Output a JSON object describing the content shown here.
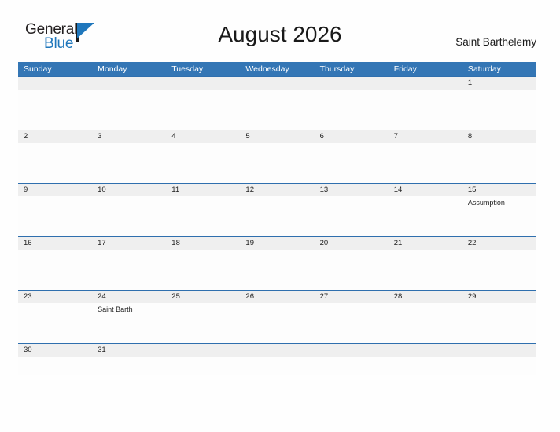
{
  "brand": {
    "name_part1": "General",
    "name_part2": "Blue",
    "flag_icon": "flag-icon",
    "accent_color": "#1f77bc"
  },
  "header": {
    "title": "August 2026",
    "region": "Saint Barthelemy"
  },
  "colors": {
    "weekday_header_bg": "#3476b5",
    "weekday_header_text": "#ffffff",
    "daynum_band_bg": "#efefef",
    "row_divider": "#2f6fae",
    "page_bg": "#fefefe",
    "text": "#222222"
  },
  "calendar": {
    "weekdays": [
      "Sunday",
      "Monday",
      "Tuesday",
      "Wednesday",
      "Thursday",
      "Friday",
      "Saturday"
    ],
    "weeks": [
      {
        "days": [
          {
            "number": "",
            "event": ""
          },
          {
            "number": "",
            "event": ""
          },
          {
            "number": "",
            "event": ""
          },
          {
            "number": "",
            "event": ""
          },
          {
            "number": "",
            "event": ""
          },
          {
            "number": "",
            "event": ""
          },
          {
            "number": "1",
            "event": ""
          }
        ]
      },
      {
        "days": [
          {
            "number": "2",
            "event": ""
          },
          {
            "number": "3",
            "event": ""
          },
          {
            "number": "4",
            "event": ""
          },
          {
            "number": "5",
            "event": ""
          },
          {
            "number": "6",
            "event": ""
          },
          {
            "number": "7",
            "event": ""
          },
          {
            "number": "8",
            "event": ""
          }
        ]
      },
      {
        "days": [
          {
            "number": "9",
            "event": ""
          },
          {
            "number": "10",
            "event": ""
          },
          {
            "number": "11",
            "event": ""
          },
          {
            "number": "12",
            "event": ""
          },
          {
            "number": "13",
            "event": ""
          },
          {
            "number": "14",
            "event": ""
          },
          {
            "number": "15",
            "event": "Assumption"
          }
        ]
      },
      {
        "days": [
          {
            "number": "16",
            "event": ""
          },
          {
            "number": "17",
            "event": ""
          },
          {
            "number": "18",
            "event": ""
          },
          {
            "number": "19",
            "event": ""
          },
          {
            "number": "20",
            "event": ""
          },
          {
            "number": "21",
            "event": ""
          },
          {
            "number": "22",
            "event": ""
          }
        ]
      },
      {
        "days": [
          {
            "number": "23",
            "event": ""
          },
          {
            "number": "24",
            "event": "Saint Barth"
          },
          {
            "number": "25",
            "event": ""
          },
          {
            "number": "26",
            "event": ""
          },
          {
            "number": "27",
            "event": ""
          },
          {
            "number": "28",
            "event": ""
          },
          {
            "number": "29",
            "event": ""
          }
        ]
      },
      {
        "short": true,
        "days": [
          {
            "number": "30",
            "event": ""
          },
          {
            "number": "31",
            "event": ""
          },
          {
            "number": "",
            "event": ""
          },
          {
            "number": "",
            "event": ""
          },
          {
            "number": "",
            "event": ""
          },
          {
            "number": "",
            "event": ""
          },
          {
            "number": "",
            "event": ""
          }
        ]
      }
    ]
  }
}
